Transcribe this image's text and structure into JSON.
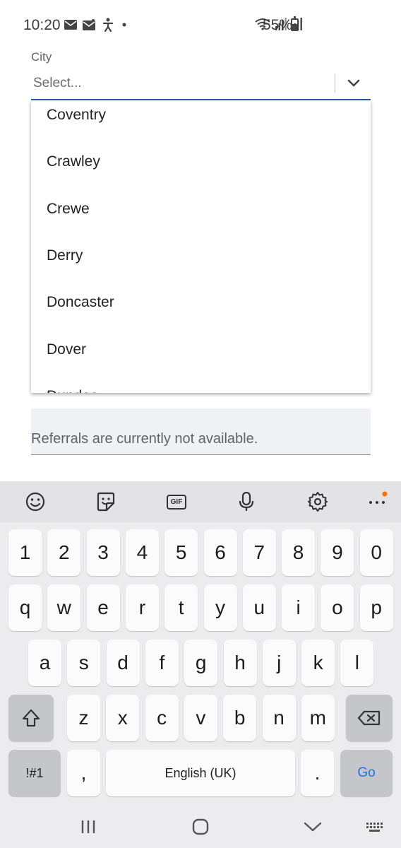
{
  "status_bar": {
    "time": "10:20",
    "battery_text": "55%",
    "battery_level": 0.55,
    "left_icons": [
      "mail-icon",
      "mail-icon",
      "accessibility-icon",
      "dot-icon"
    ],
    "right_icons": [
      "wifi-icon",
      "signal-icon",
      "signal-icon"
    ]
  },
  "form": {
    "city_label": "City",
    "city_select": {
      "value": "Select...",
      "options": [
        "Coventry",
        "Crawley",
        "Crewe",
        "Derry",
        "Doncaster",
        "Dover",
        "Dundee"
      ]
    },
    "referrals_notice": "Referrals are currently not available."
  },
  "keyboard": {
    "toolbar": [
      "emoji-icon",
      "sticker-icon",
      "gif-icon",
      "microphone-icon",
      "settings-icon",
      "more-icon"
    ],
    "row_numbers": [
      "1",
      "2",
      "3",
      "4",
      "5",
      "6",
      "7",
      "8",
      "9",
      "0"
    ],
    "row_top": [
      "q",
      "w",
      "e",
      "r",
      "t",
      "y",
      "u",
      "i",
      "o",
      "p"
    ],
    "row_middle": [
      "a",
      "s",
      "d",
      "f",
      "g",
      "h",
      "j",
      "k",
      "l"
    ],
    "row_bottom": [
      "z",
      "x",
      "c",
      "v",
      "b",
      "n",
      "m"
    ],
    "symbols_key": "!#1",
    "comma_key": ",",
    "space_label": "English (UK)",
    "period_key": ".",
    "go_key": "Go",
    "gif_label": "GIF"
  },
  "colors": {
    "accent": "#1f5ca8",
    "go": "#1a73e8",
    "notification_dot": "#ff6d00"
  }
}
